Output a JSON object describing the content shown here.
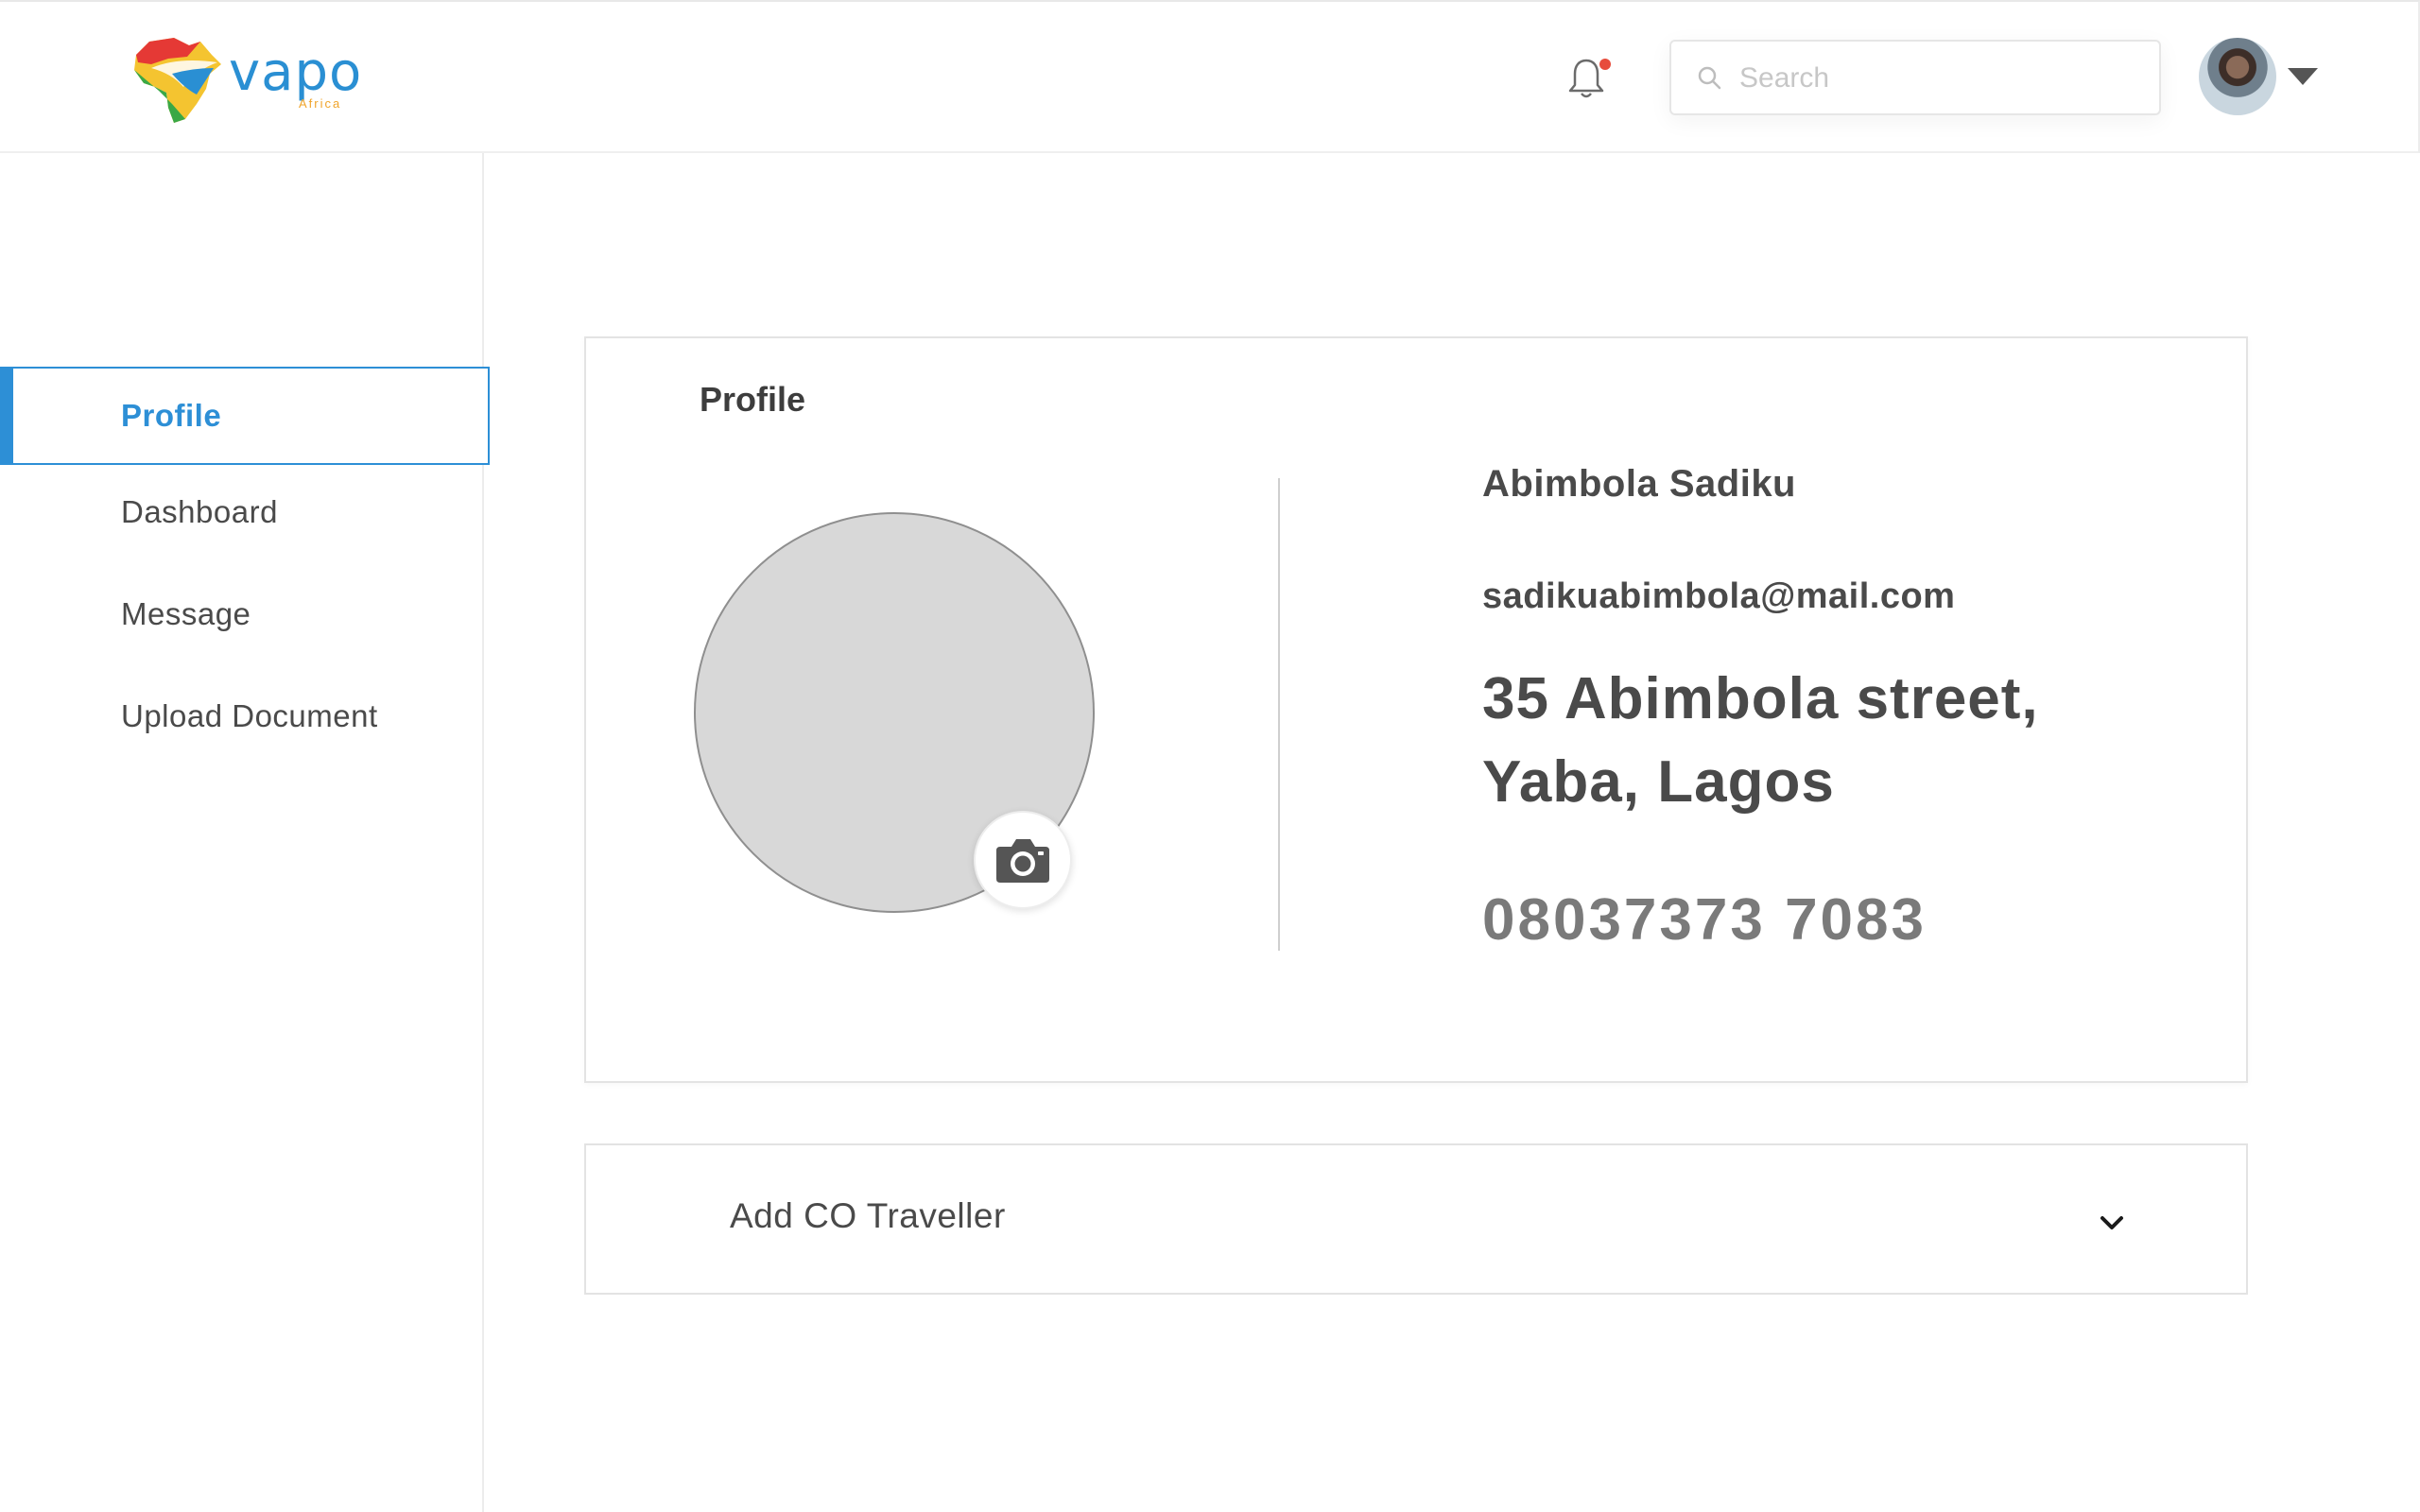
{
  "brand": {
    "name": "vapo",
    "tagline": "Africa"
  },
  "header": {
    "search": {
      "placeholder": "Search",
      "value": ""
    },
    "notification": {
      "has_unread": true
    }
  },
  "sidebar": {
    "items": [
      {
        "label": "Profile",
        "active": true
      },
      {
        "label": "Dashboard",
        "active": false
      },
      {
        "label": "Message",
        "active": false
      },
      {
        "label": "Upload Document",
        "active": false
      }
    ]
  },
  "profile": {
    "title": "Profile",
    "name": "Abimbola Sadiku",
    "email": "sadikuabimbola@mail.com",
    "address": "35 Abimbola street, Yaba, Lagos",
    "phone": "08037373 7083"
  },
  "co_traveller": {
    "label": "Add CO Traveller"
  },
  "colors": {
    "accent": "#2d8fd6",
    "notification_dot": "#e74c3c",
    "text": "#4a4a4a",
    "phone_text": "#7a7a7a",
    "photo_placeholder": "#d8d8d8"
  },
  "icons": [
    "africa-logo-icon",
    "bell-icon",
    "search-icon",
    "avatar",
    "caret-down-icon",
    "camera-icon",
    "chevron-down-icon"
  ]
}
